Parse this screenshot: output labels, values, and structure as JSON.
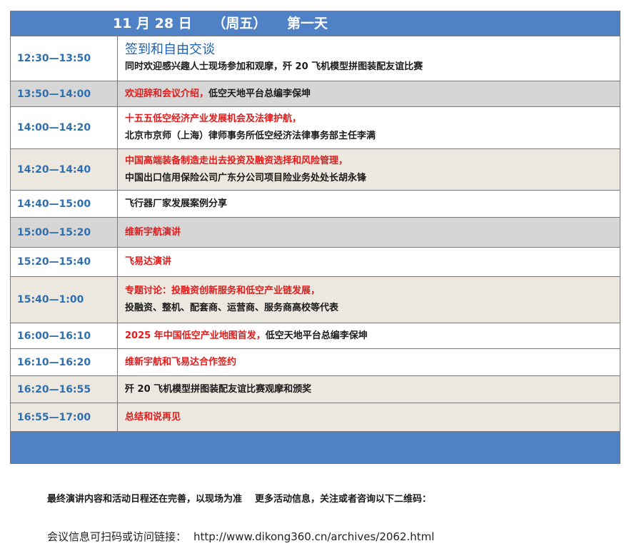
{
  "header": {
    "date": "11 月 28 日",
    "weekday": "（周五）",
    "day": "第一天"
  },
  "schedule": [
    {
      "time": "12:30—13:50",
      "lines": [
        "签到和自由交谈",
        "同时欢迎感兴趣人士现场参加和观摩，歼 20 飞机模型拼图装配友谊比赛"
      ]
    },
    {
      "time": "13:50—14:00",
      "red": "欢迎辞和会议介绍，",
      "black": "低空天地平台总编李保坤"
    },
    {
      "time": "14:00—14:20",
      "lines": [
        "十五五低空经济产业发展机会及法律护航，",
        "北京市京师（上海）律师事务所低空经济法律事务部主任李满"
      ]
    },
    {
      "time": "14:20—14:40",
      "lines": [
        "中国高端装备制造走出去投资及融资选择和风险管理，",
        "中国出口信用保险公司广东分公司项目险业务处处长胡永锋"
      ]
    },
    {
      "time": "14:40—15:00",
      "lines": [
        "飞行器厂家发展案例分享"
      ]
    },
    {
      "time": "15:00—15:20",
      "lines": [
        "维新宇航演讲"
      ]
    },
    {
      "time": "15:20—15:40",
      "lines": [
        "飞易达演讲"
      ]
    },
    {
      "time": "15:40—1:00",
      "lines": [
        "专题讨论：投融资创新服务和低空产业链发展，",
        "投融资、整机、配套商、运营商、服务商高校等代表"
      ]
    },
    {
      "time": "16:00—16:10",
      "red": "2025 年中国低空产业地图首发，",
      "black": "低空天地平台总编李保坤"
    },
    {
      "time": "16:10—16:20",
      "lines": [
        "维新宇航和飞易达合作签约"
      ]
    },
    {
      "time": "16:20—16:55",
      "lines": [
        "歼 20 飞机模型拼图装配友谊比赛观摩和颁奖"
      ]
    },
    {
      "time": "16:55—17:00",
      "lines": [
        "总结和说再见"
      ]
    }
  ],
  "footer": {
    "note_part1": "最终演讲内容和活动日程还在完善，以现场为准",
    "note_part2": "更多活动信息，关注或者咨询以下二维码：",
    "link_label": "会议信息可扫码或访问链接：",
    "link_url": "http://www.dikong360.cn/archives/2062.html"
  },
  "colors": {
    "header_blue": "#4f81c7",
    "time_blue": "#2f6fae",
    "red_text": "#e01b1b",
    "row_gray": "#d6d6d6",
    "row_beige": "#ece8df"
  }
}
